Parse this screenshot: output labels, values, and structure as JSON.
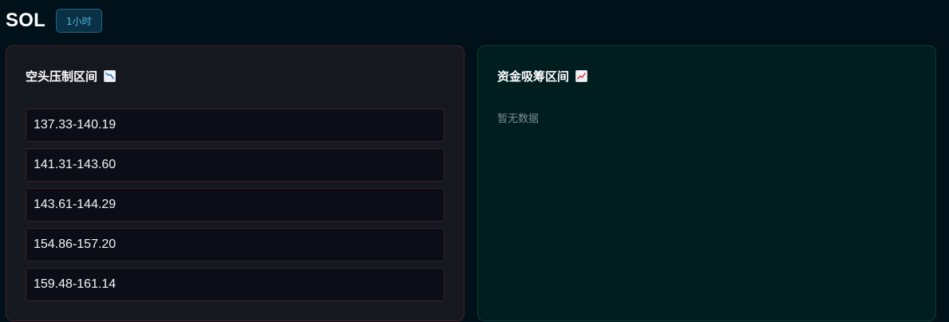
{
  "header": {
    "symbol": "SOL",
    "timeframe": "1小时"
  },
  "short_panel": {
    "title": "空头压制区间",
    "icon": "chart-decreasing-icon",
    "zones": [
      "137.33-140.19",
      "141.31-143.60",
      "143.61-144.29",
      "154.86-157.20",
      "159.48-161.14"
    ]
  },
  "long_panel": {
    "title": "资金吸筹区间",
    "icon": "chart-increasing-icon",
    "empty_text": "暂无数据"
  },
  "colors": {
    "page_bg": "#00111a",
    "short_panel_bg": "#161820",
    "short_panel_border": "#4a2226",
    "long_panel_bg": "#001e20",
    "long_panel_border": "#0f3a37",
    "badge_text": "#4fb6e0",
    "chart_down": "#3a7be0",
    "chart_up": "#e04a4a"
  }
}
